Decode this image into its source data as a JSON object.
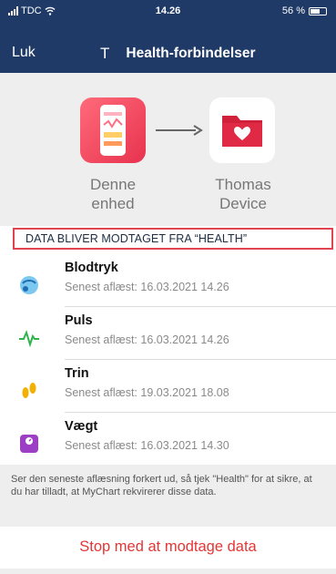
{
  "status_bar": {
    "carrier": "TDC",
    "time": "14.26",
    "battery": "56 %"
  },
  "nav": {
    "close_label": "Luk",
    "avatar_letter": "T",
    "title": "Health-forbindelser"
  },
  "connection": {
    "source_line1": "Denne",
    "source_line2": "enhed",
    "target_line1": "Thomas",
    "target_line2": "Device"
  },
  "section_header": "DATA BLIVER MODTAGET FRA “HEALTH”",
  "items": [
    {
      "name": "Blodtryk",
      "last_read": "Senest aflæst: 16.03.2021 14.26"
    },
    {
      "name": "Puls",
      "last_read": "Senest aflæst: 16.03.2021 14.26"
    },
    {
      "name": "Trin",
      "last_read": "Senest aflæst: 19.03.2021 18.08"
    },
    {
      "name": "Vægt",
      "last_read": "Senest aflæst: 16.03.2021 14.30"
    }
  ],
  "info_text": "Ser den seneste aflæsning forkert ud, så tjek \"Health\" for at sikre, at du har tilladt, at MyChart rekvirerer disse data.",
  "stop_label": "Stop med at modtage data",
  "colors": {
    "header_bg": "#1f3a66",
    "accent_red": "#e53535",
    "section_outline": "#e0454f"
  }
}
